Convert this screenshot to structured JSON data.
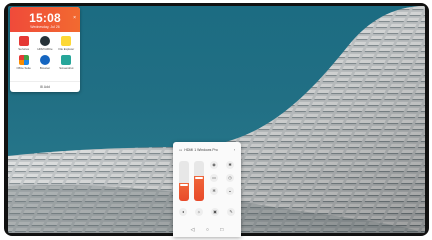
{
  "clock": {
    "time": "15:08",
    "date": "Wednesday, Jul 26"
  },
  "apps": [
    {
      "label": "Services",
      "color": "#e53935",
      "icon": "document-icon"
    },
    {
      "label": "HDMI ARCe",
      "color": "#263238",
      "icon": "gear-icon"
    },
    {
      "label": "File Explorer",
      "color": "#fdd835",
      "icon": "folder-icon"
    },
    {
      "label": "Office Suite",
      "color": "#43a047",
      "icon": "grid-icon"
    },
    {
      "label": "Browser",
      "color": "#1565c0",
      "icon": "globe-icon"
    },
    {
      "label": "Screenshot",
      "color": "#26a69a",
      "icon": "layers-icon"
    }
  ],
  "widget": {
    "more_label": "Add"
  },
  "control": {
    "source_label": "HDMI 1 Windows Pro",
    "brightness": 0.45,
    "volume": 0.62
  },
  "colors": {
    "accent": "#f04a3a"
  }
}
